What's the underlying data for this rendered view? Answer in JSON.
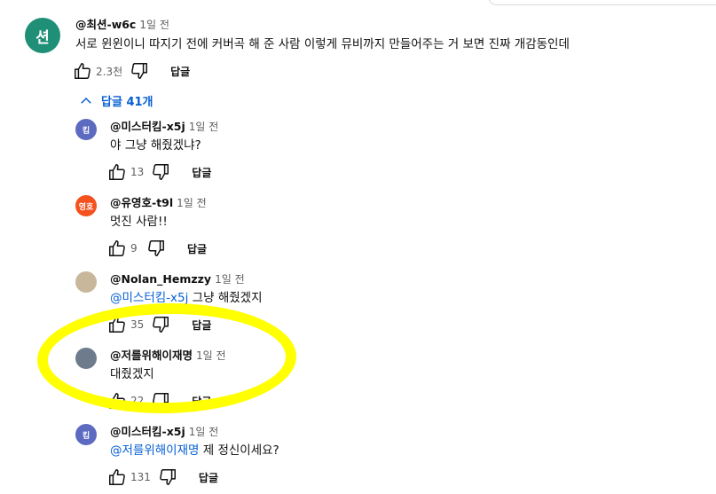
{
  "top_comment": {
    "avatar_text": "션",
    "handle": "@최션-w6c",
    "time": "1일 전",
    "text": "서로 윈윈이니 따지기 전에 커버곡 해 준 사람 이렇게 뮤비까지 만들어주는 거 보면 진짜 개감동인데",
    "likes": "2.3천",
    "reply_label": "답글"
  },
  "replies_toggle": {
    "label": "답글 41개"
  },
  "replies": [
    {
      "avatar_text": "킴",
      "avatar_color": "#5c6bc0",
      "handle": "@미스터킴-x5j",
      "time": "1일 전",
      "mention": "",
      "text": "야 그냥 해줬겠냐?",
      "likes": "13",
      "reply_label": "답글"
    },
    {
      "avatar_text": "영호",
      "avatar_color": "#f4511e",
      "handle": "@유영호-t9l",
      "time": "1일 전",
      "mention": "",
      "text": "멋진 사람!!",
      "likes": "9",
      "reply_label": "답글"
    },
    {
      "avatar_text": "",
      "avatar_color": "#c9b79c",
      "handle": "@Nolan_Hemzzy",
      "time": "1일 전",
      "mention": "@미스터킴-x5j",
      "text": " 그냥 해줬겠지",
      "likes": "35",
      "reply_label": "답글"
    },
    {
      "avatar_text": "",
      "avatar_color": "#6d7b8d",
      "handle": "@저를위해이재명",
      "time": "1일 전",
      "mention": "",
      "text": "대줬겠지",
      "likes": "22",
      "reply_label": "답글"
    },
    {
      "avatar_text": "킴",
      "avatar_color": "#5c6bc0",
      "handle": "@미스터킴-x5j",
      "time": "1일 전",
      "mention": "@저를위해이재명",
      "text": " 제 정신이세요?",
      "likes": "131",
      "reply_label": "답글"
    }
  ],
  "icons": {
    "like": "thumb-up-icon",
    "dislike": "thumb-down-icon",
    "toggle": "chevron-up-icon"
  },
  "colors": {
    "link": "#065fd4",
    "highlight": "#ffff00",
    "main_avatar": "#1f8f78"
  }
}
